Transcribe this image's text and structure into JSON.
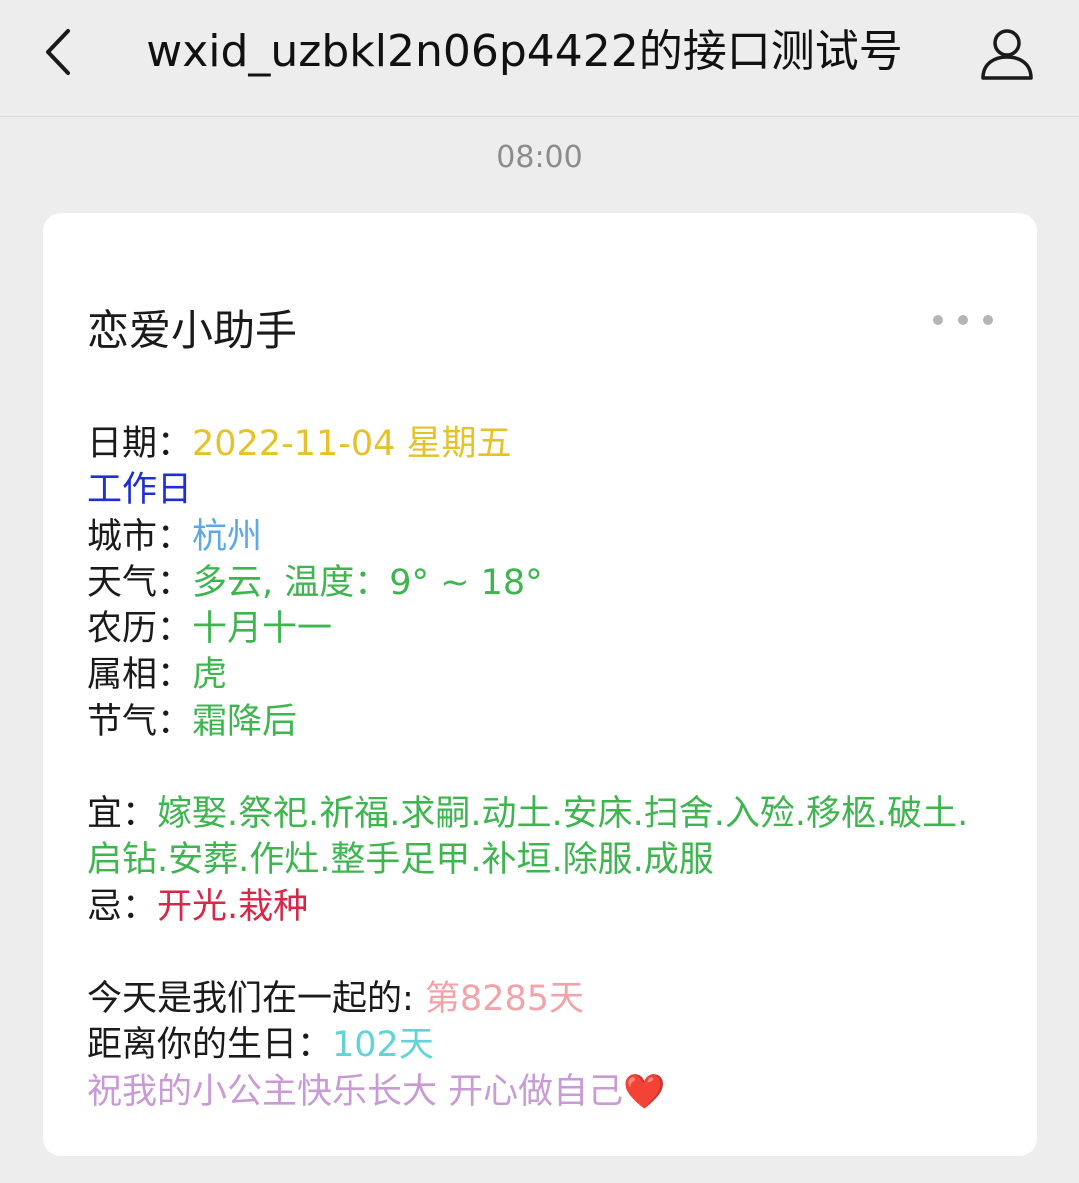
{
  "header": {
    "title": "wxid_uzbkl2n06p4422的接口测试号",
    "back_icon": "chevron-left-icon",
    "profile_icon": "user-icon"
  },
  "timestamp": "08:00",
  "card": {
    "title": "恋爱小助手",
    "more_icon": "more-dots-icon",
    "date_label": "日期：",
    "date_value": "2022-11-04 星期五",
    "workday": "工作日",
    "city_label": "城市：",
    "city_value": "杭州",
    "weather_label": "天气：",
    "weather_value": "多云, 温度：9° ~ 18°",
    "lunar_label": "农历：",
    "lunar_value": "十月十一",
    "zodiac_label": "属相：",
    "zodiac_value": "虎",
    "solar_term_label": "节气：",
    "solar_term_value": "霜降后",
    "suitable_label": "宜：",
    "suitable_value": "嫁娶.祭祀.祈福.求嗣.动土.安床.扫舍.入殓.移柩.破土.启钻.安葬.作灶.整手足甲.补垣.除服.成服",
    "avoid_label": "忌：",
    "avoid_value": "开光.栽种",
    "together_label": "今天是我们在一起的: ",
    "together_value": "第8285天",
    "birthday_label": "距离你的生日：",
    "birthday_value": "102天",
    "wish": "祝我的小公主快乐长大 开心做自己",
    "heart": "❤️"
  },
  "colors": {
    "date": "#e6c229",
    "workday": "#1f2fd1",
    "city": "#5ea8e6",
    "green": "#3fb550",
    "avoid": "#d8284a",
    "together": "#f3a3a8",
    "birthday": "#5fd4d9",
    "wish": "#c89bd6"
  }
}
